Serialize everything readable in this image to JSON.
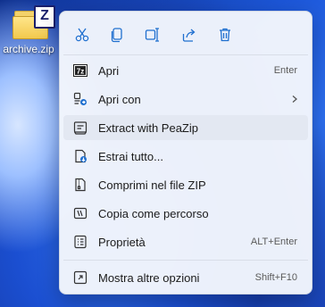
{
  "desktop": {
    "file_label": "archive.zip",
    "file_badge": "Z"
  },
  "toolbar": {
    "buttons": [
      {
        "name": "cut",
        "icon": "scissors-icon"
      },
      {
        "name": "copy",
        "icon": "copy-icon"
      },
      {
        "name": "rename",
        "icon": "rename-icon"
      },
      {
        "name": "share",
        "icon": "share-icon"
      },
      {
        "name": "delete",
        "icon": "trash-icon"
      }
    ]
  },
  "menu": {
    "items": [
      {
        "label": "Apri",
        "shortcut": "Enter",
        "icon": "7zip-icon"
      },
      {
        "label": "Apri con",
        "shortcut": "",
        "icon": "open-with-icon",
        "submenu": true
      },
      {
        "label": "Extract with PeaZip",
        "shortcut": "",
        "icon": "peazip-icon",
        "highlighted": true
      },
      {
        "label": "Estrai tutto...",
        "shortcut": "",
        "icon": "extract-all-icon"
      },
      {
        "label": "Comprimi nel file ZIP",
        "shortcut": "",
        "icon": "zip-icon"
      },
      {
        "label": "Copia come percorso",
        "shortcut": "",
        "icon": "copy-path-icon"
      },
      {
        "label": "Proprietà",
        "shortcut": "ALT+Enter",
        "icon": "properties-icon"
      },
      {
        "label": "Mostra altre opzioni",
        "shortcut": "Shift+F10",
        "icon": "more-options-icon"
      }
    ]
  },
  "colors": {
    "accent": "#1f6fcf",
    "menu_bg": "#f3f6fc",
    "highlight": "#e3e8f2"
  }
}
